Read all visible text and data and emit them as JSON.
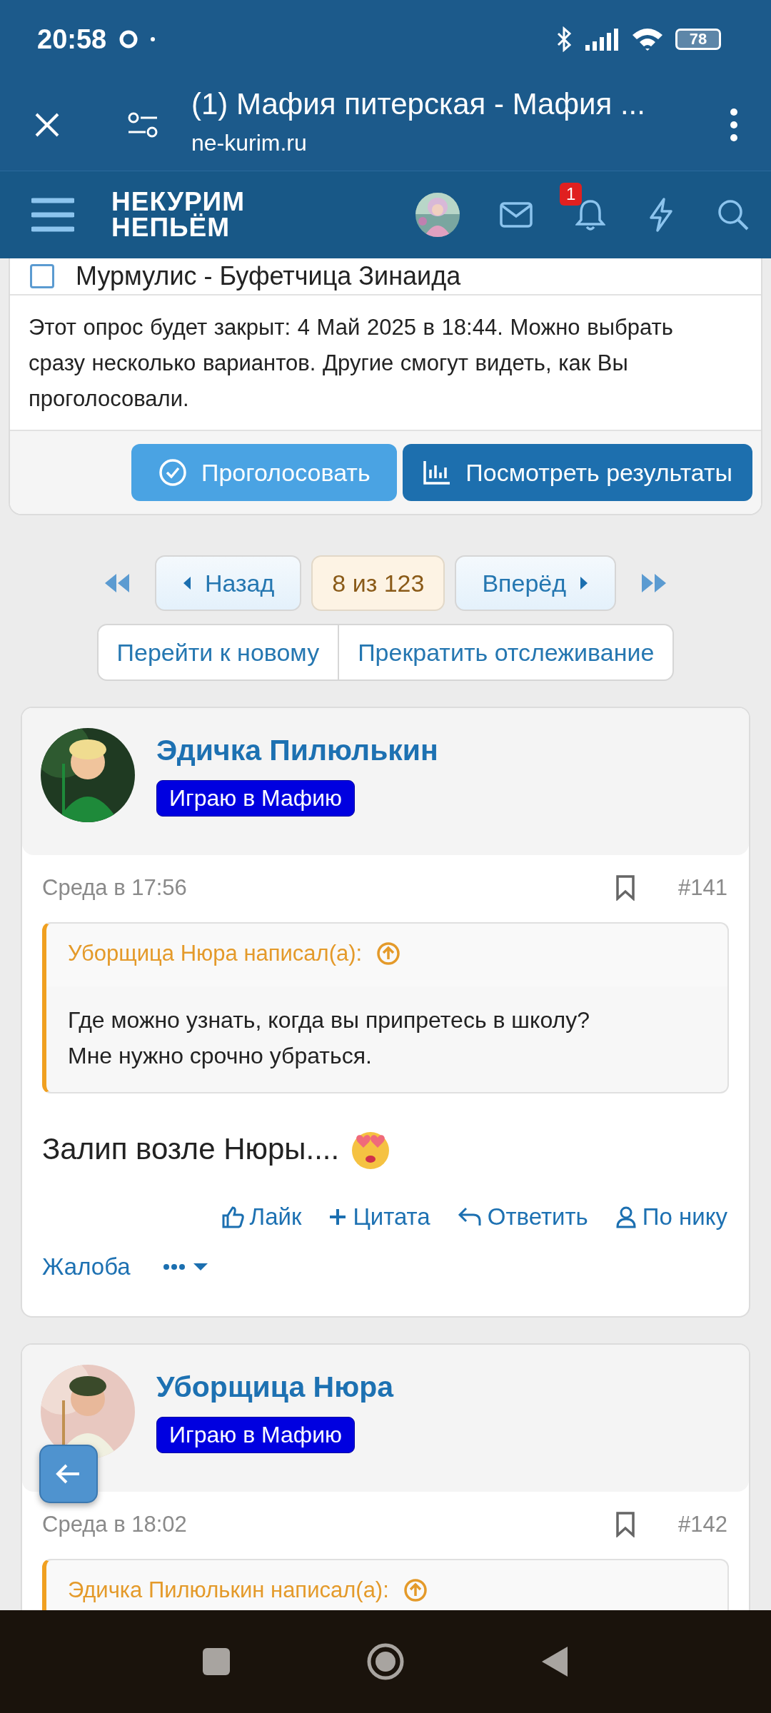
{
  "status_bar": {
    "time": "20:58",
    "battery": "78"
  },
  "browser": {
    "title": "(1) Мафия питерская - Мафия ...",
    "url": "ne-kurim.ru"
  },
  "site_header": {
    "logo_line_1": "НЕКУРИМ",
    "logo_line_2": "НЕПЬЁМ",
    "notifications_badge": "1"
  },
  "poll": {
    "option": {
      "label": "Мурмулис - Буфетчица Зинаида",
      "checked": false
    },
    "note": "Этот опрос будет закрыт: 4 Май 2025 в 18:44. Можно выбрать сразу несколько вариантов. Другие смогут видеть, как Вы проголосовали.",
    "buttons": [
      {
        "label": "Проголосовать",
        "kind": "vote"
      },
      {
        "label": "Посмотреть результаты",
        "kind": "results"
      }
    ]
  },
  "pagination": {
    "prev": "Назад",
    "current": "8 из 123",
    "next": "Вперёд"
  },
  "thread_actions": [
    "Перейти к новому",
    "Прекратить отслеживание"
  ],
  "posts": [
    {
      "author": "Эдичка Пилюлькин",
      "badge": "Играю в Мафию",
      "date": "Среда в 17:56",
      "number": "#141",
      "quote": {
        "header": "Уборщица Нюра написал(а):",
        "text": "Где можно узнать, когда вы припретесь в школу?\nМне нужно срочно убраться."
      },
      "body": "Залип возле Нюры....",
      "actions": [
        {
          "label": "Лайк",
          "kind": "like"
        },
        {
          "label": "Цитата",
          "kind": "quote"
        },
        {
          "label": "Ответить",
          "kind": "reply"
        },
        {
          "label": "По нику",
          "kind": "user"
        }
      ],
      "footer_link": "Жалоба"
    },
    {
      "author": "Уборщица Нюра",
      "badge": "Играю в Мафию",
      "date": "Среда в 18:02",
      "number": "#142",
      "quote": {
        "header": "Эдичка Пилюлькин написал(а):"
      }
    }
  ]
}
